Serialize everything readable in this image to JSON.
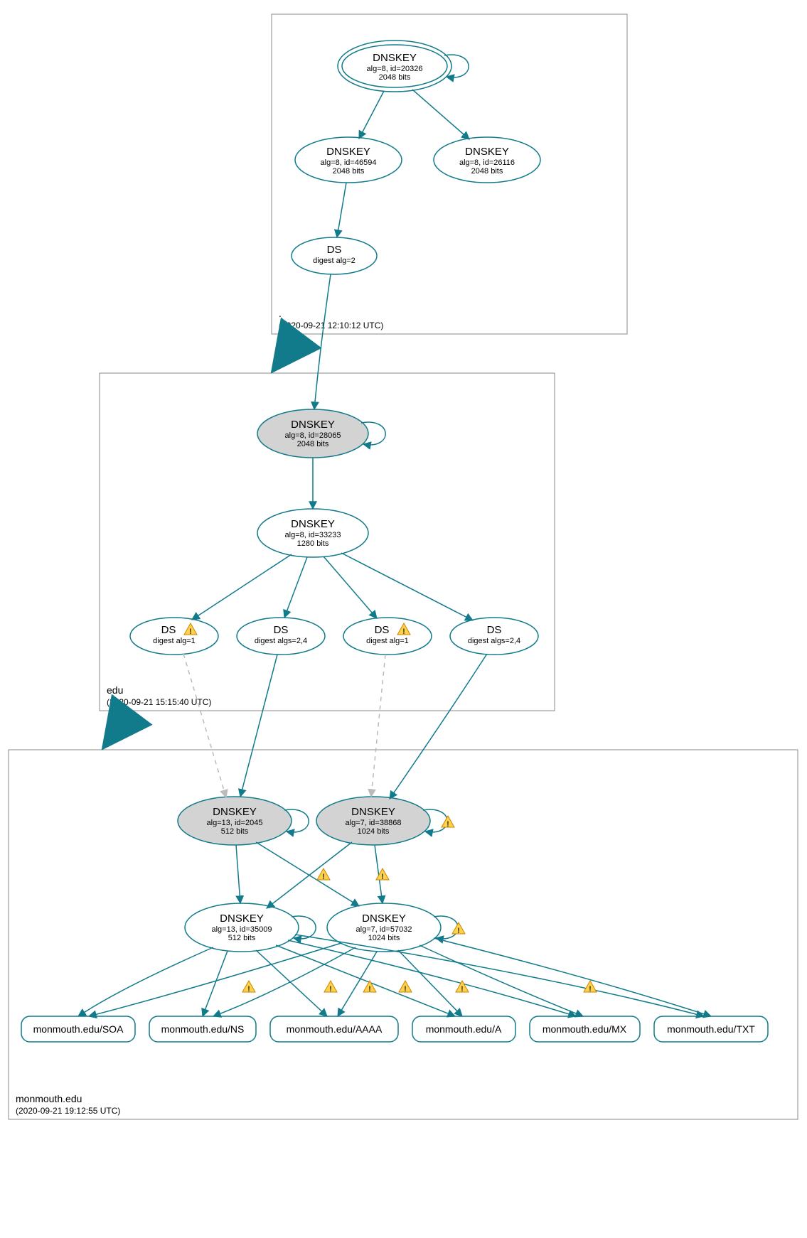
{
  "zones": {
    "root": {
      "name": ".",
      "timestamp": "(2020-09-21 12:10:12 UTC)"
    },
    "edu": {
      "name": "edu",
      "timestamp": "(2020-09-21 15:15:40 UTC)"
    },
    "monmouth": {
      "name": "monmouth.edu",
      "timestamp": "(2020-09-21 19:12:55 UTC)"
    }
  },
  "nodes": {
    "root_ksk": {
      "title": "DNSKEY",
      "sub1": "alg=8, id=20326",
      "sub2": "2048 bits"
    },
    "root_zsk1": {
      "title": "DNSKEY",
      "sub1": "alg=8, id=46594",
      "sub2": "2048 bits"
    },
    "root_zsk2": {
      "title": "DNSKEY",
      "sub1": "alg=8, id=26116",
      "sub2": "2048 bits"
    },
    "root_ds": {
      "title": "DS",
      "sub1": "digest alg=2"
    },
    "edu_ksk": {
      "title": "DNSKEY",
      "sub1": "alg=8, id=28065",
      "sub2": "2048 bits"
    },
    "edu_zsk": {
      "title": "DNSKEY",
      "sub1": "alg=8, id=33233",
      "sub2": "1280 bits"
    },
    "edu_ds1": {
      "title": "DS",
      "sub1": "digest alg=1"
    },
    "edu_ds2": {
      "title": "DS",
      "sub1": "digest algs=2,4"
    },
    "edu_ds3": {
      "title": "DS",
      "sub1": "digest alg=1"
    },
    "edu_ds4": {
      "title": "DS",
      "sub1": "digest algs=2,4"
    },
    "m_ksk1": {
      "title": "DNSKEY",
      "sub1": "alg=13, id=2045",
      "sub2": "512 bits"
    },
    "m_ksk2": {
      "title": "DNSKEY",
      "sub1": "alg=7, id=38868",
      "sub2": "1024 bits"
    },
    "m_zsk1": {
      "title": "DNSKEY",
      "sub1": "alg=13, id=35009",
      "sub2": "512 bits"
    },
    "m_zsk2": {
      "title": "DNSKEY",
      "sub1": "alg=7, id=57032",
      "sub2": "1024 bits"
    }
  },
  "rrsets": {
    "soa": "monmouth.edu/SOA",
    "ns": "monmouth.edu/NS",
    "aaaa": "monmouth.edu/AAAA",
    "a": "monmouth.edu/A",
    "mx": "monmouth.edu/MX",
    "txt": "monmouth.edu/TXT"
  }
}
